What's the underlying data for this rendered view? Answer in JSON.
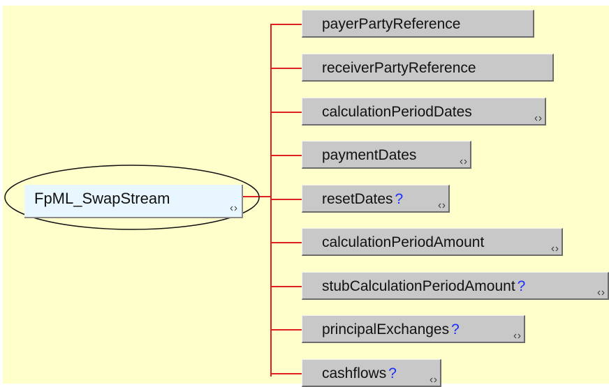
{
  "root": {
    "label": "FpML_SwapStream",
    "expander_icon": "expand-children-icon"
  },
  "children": [
    {
      "name": "payerPartyReference",
      "optional": false,
      "expandable": false
    },
    {
      "name": "receiverPartyReference",
      "optional": false,
      "expandable": false
    },
    {
      "name": "calculationPeriodDates",
      "optional": false,
      "expandable": true
    },
    {
      "name": "paymentDates",
      "optional": false,
      "expandable": true
    },
    {
      "name": "resetDates",
      "optional": true,
      "expandable": true
    },
    {
      "name": "calculationPeriodAmount",
      "optional": false,
      "expandable": true
    },
    {
      "name": "stubCalculationPeriodAmount",
      "optional": true,
      "expandable": true
    },
    {
      "name": "principalExchanges",
      "optional": true,
      "expandable": true
    },
    {
      "name": "cashflows",
      "optional": true,
      "expandable": true
    }
  ],
  "optional_marker": "?",
  "colors": {
    "background": "#ffffcc",
    "connector": "#dd1f1f",
    "node_fill": "#c8c8c8",
    "root_fill": "#e8f7ff",
    "optional_marker": "#1a2cff"
  }
}
